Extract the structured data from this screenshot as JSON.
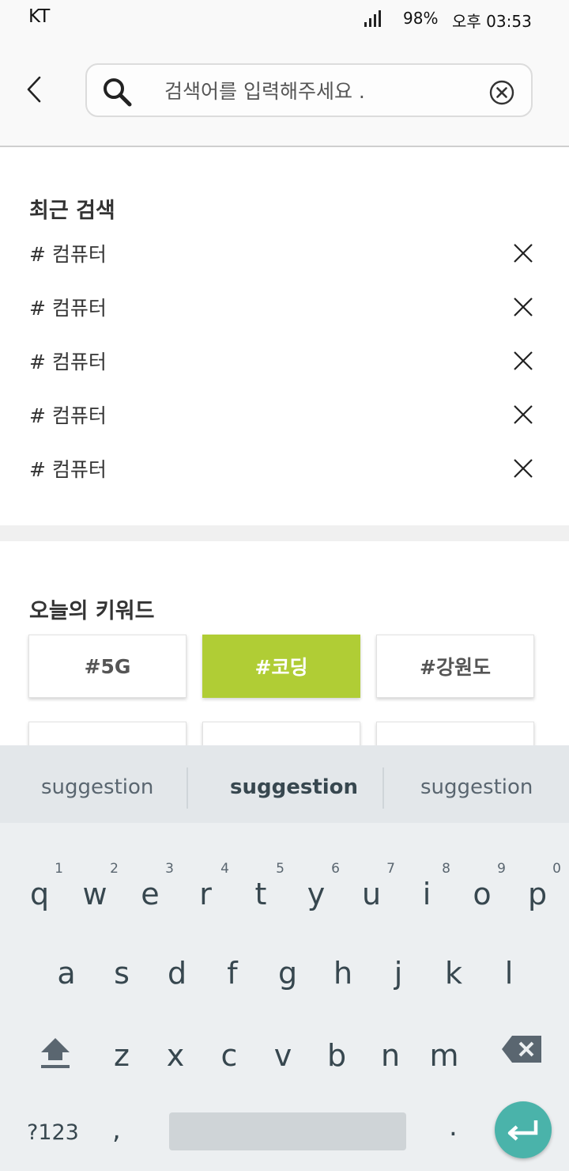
{
  "status_bar": {
    "carrier": "KT",
    "battery": "98%",
    "time": "오후 03:53",
    "signal_icon": "signal-bars-icon"
  },
  "header": {
    "back_icon": "chevron-left-icon",
    "search_icon": "search-icon",
    "search_placeholder": "검색어를 입력해주세요 .",
    "search_value": "",
    "clear_icon": "clear-circle-icon"
  },
  "recent": {
    "title": "최근 검색",
    "items": [
      {
        "label": "# 컴퓨터"
      },
      {
        "label": "# 컴퓨터"
      },
      {
        "label": "# 컴퓨터"
      },
      {
        "label": "# 컴퓨터"
      },
      {
        "label": "# 컴퓨터"
      }
    ],
    "remove_icon": "close-icon"
  },
  "keywords": {
    "title": "오늘의 키워드",
    "chips": [
      {
        "label": "#5G",
        "active": false
      },
      {
        "label": "#코딩",
        "active": true
      },
      {
        "label": "#강원도",
        "active": false
      }
    ],
    "accent_color": "#b0cd35"
  },
  "keyboard": {
    "suggestions": [
      "suggestion",
      "suggestion",
      "suggestion"
    ],
    "row1": [
      {
        "ch": "q",
        "num": "1"
      },
      {
        "ch": "w",
        "num": "2"
      },
      {
        "ch": "e",
        "num": "3"
      },
      {
        "ch": "r",
        "num": "4"
      },
      {
        "ch": "t",
        "num": "5"
      },
      {
        "ch": "y",
        "num": "6"
      },
      {
        "ch": "u",
        "num": "7"
      },
      {
        "ch": "i",
        "num": "8"
      },
      {
        "ch": "o",
        "num": "9"
      },
      {
        "ch": "p",
        "num": "0"
      }
    ],
    "row2": [
      "a",
      "s",
      "d",
      "f",
      "g",
      "h",
      "j",
      "k",
      "l"
    ],
    "row3": [
      "z",
      "x",
      "c",
      "v",
      "b",
      "n",
      "m"
    ],
    "symbols_label": "?123",
    "comma_label": ",",
    "period_label": ".",
    "shift_icon": "shift-arrow-icon",
    "backspace_icon": "backspace-icon",
    "enter_icon": "enter-return-icon",
    "enter_color": "#4ab3aa"
  }
}
